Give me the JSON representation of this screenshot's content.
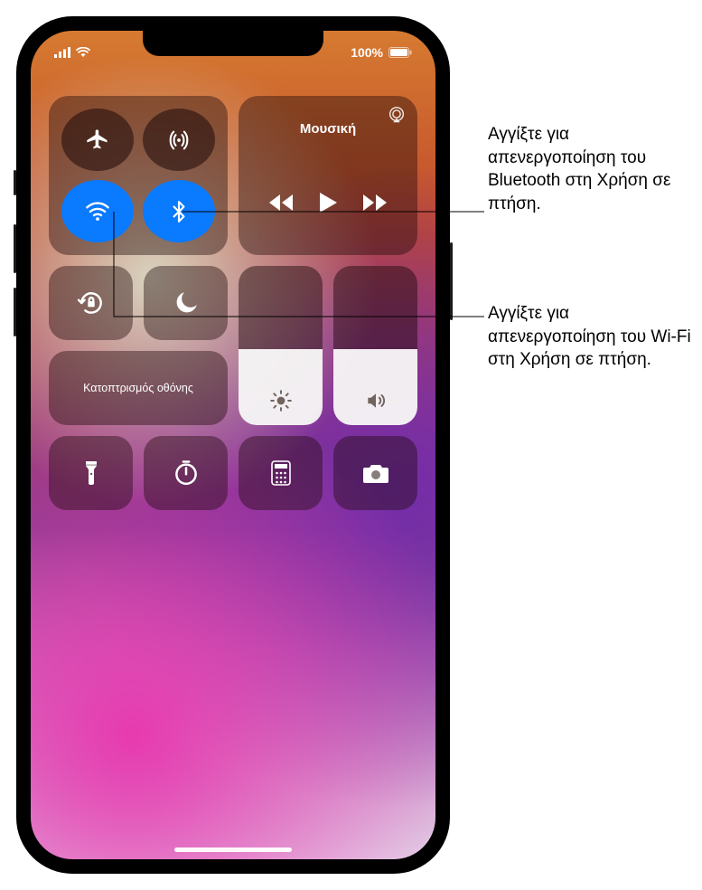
{
  "status": {
    "battery_text": "100%"
  },
  "connectivity": {
    "airplane_icon": "airplane-icon",
    "cellular_icon": "cellular-data-icon",
    "wifi_icon": "wifi-icon",
    "bluetooth_icon": "bluetooth-icon"
  },
  "media": {
    "title": "Μουσική"
  },
  "tiles": {
    "orientation_lock": "orientation-lock-icon",
    "dnd": "do-not-disturb-icon",
    "flashlight": "flashlight-icon",
    "timer": "timer-icon",
    "calculator": "calculator-icon",
    "camera": "camera-icon"
  },
  "mirror": {
    "label": "Κατοπτρισμός οθόνης"
  },
  "sliders": {
    "brightness_pct": 48,
    "volume_pct": 48
  },
  "callouts": {
    "bluetooth": "Αγγίξτε για απενεργοποίηση του Bluetooth στη Χρήση σε πτήση.",
    "wifi": "Αγγίξτε για απενεργοποίηση του Wi-Fi στη Χρήση σε πτήση."
  }
}
